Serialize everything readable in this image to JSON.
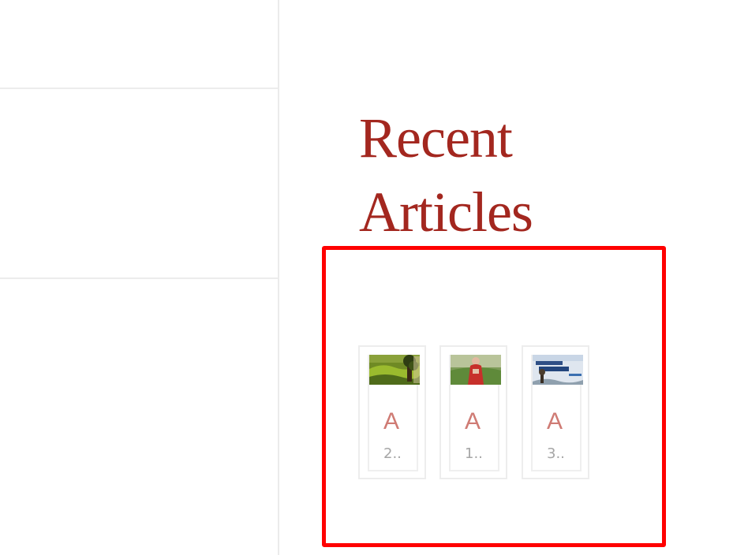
{
  "sidebar": {
    "widget_title": "Recent Articles",
    "articles": [
      {
        "title": "A",
        "date": "2..",
        "thumbnail": "landscape-painting-with-tree"
      },
      {
        "title": "A",
        "date": "1..",
        "thumbnail": "painting-of-woman-in-red-dress"
      },
      {
        "title": "A",
        "date": "3..",
        "thumbnail": "landscape-book-cover"
      }
    ]
  },
  "colors": {
    "title": "#a3271f",
    "article_title": "#cf7b74",
    "article_date": "#a6a6a6",
    "highlight_frame": "#ff0000",
    "divider": "#ececec"
  }
}
